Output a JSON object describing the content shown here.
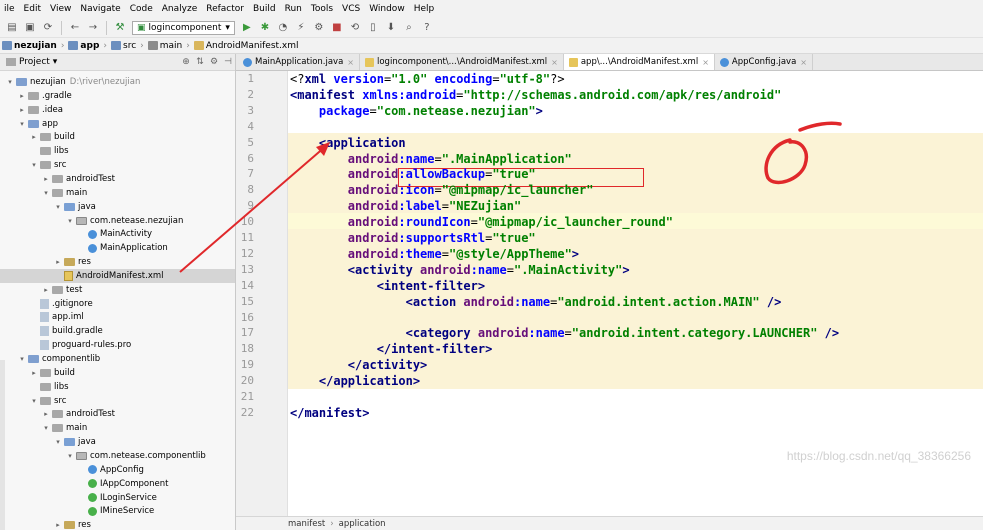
{
  "menu": [
    "ile",
    "Edit",
    "View",
    "Navigate",
    "Code",
    "Analyze",
    "Refactor",
    "Build",
    "Run",
    "Tools",
    "VCS",
    "Window",
    "Help"
  ],
  "toolbar": {
    "run_config": "logincomponent"
  },
  "breadcrumb": [
    "nezujian",
    "app",
    "src",
    "main",
    "AndroidManifest.xml"
  ],
  "project_panel": {
    "title": "Project",
    "tree": [
      {
        "label": "nezujian",
        "extra": "D:\\river\\nezujian",
        "indent": 0,
        "arrow": "▾",
        "icon": "mod"
      },
      {
        "label": ".gradle",
        "indent": 1,
        "arrow": "▸",
        "icon": "folder"
      },
      {
        "label": ".idea",
        "indent": 1,
        "arrow": "▸",
        "icon": "folder"
      },
      {
        "label": "app",
        "indent": 1,
        "arrow": "▾",
        "icon": "mod"
      },
      {
        "label": "build",
        "indent": 2,
        "arrow": "▸",
        "icon": "folder"
      },
      {
        "label": "libs",
        "indent": 2,
        "arrow": "",
        "icon": "folder"
      },
      {
        "label": "src",
        "indent": 2,
        "arrow": "▾",
        "icon": "folder"
      },
      {
        "label": "androidTest",
        "indent": 3,
        "arrow": "▸",
        "icon": "folder"
      },
      {
        "label": "main",
        "indent": 3,
        "arrow": "▾",
        "icon": "folder"
      },
      {
        "label": "java",
        "indent": 4,
        "arrow": "▾",
        "icon": "src"
      },
      {
        "label": "com.netease.nezujian",
        "indent": 5,
        "arrow": "▾",
        "icon": "pkg"
      },
      {
        "label": "MainActivity",
        "indent": 6,
        "arrow": "",
        "icon": "class"
      },
      {
        "label": "MainApplication",
        "indent": 6,
        "arrow": "",
        "icon": "class"
      },
      {
        "label": "res",
        "indent": 4,
        "arrow": "▸",
        "icon": "res"
      },
      {
        "label": "AndroidManifest.xml",
        "indent": 4,
        "arrow": "",
        "icon": "xml",
        "selected": true
      },
      {
        "label": "test",
        "indent": 3,
        "arrow": "▸",
        "icon": "folder"
      },
      {
        "label": ".gitignore",
        "indent": 2,
        "arrow": "",
        "icon": "file"
      },
      {
        "label": "app.iml",
        "indent": 2,
        "arrow": "",
        "icon": "file"
      },
      {
        "label": "build.gradle",
        "indent": 2,
        "arrow": "",
        "icon": "file"
      },
      {
        "label": "proguard-rules.pro",
        "indent": 2,
        "arrow": "",
        "icon": "file"
      },
      {
        "label": "componentlib",
        "indent": 1,
        "arrow": "▾",
        "icon": "mod"
      },
      {
        "label": "build",
        "indent": 2,
        "arrow": "▸",
        "icon": "folder"
      },
      {
        "label": "libs",
        "indent": 2,
        "arrow": "",
        "icon": "folder"
      },
      {
        "label": "src",
        "indent": 2,
        "arrow": "▾",
        "icon": "folder"
      },
      {
        "label": "androidTest",
        "indent": 3,
        "arrow": "▸",
        "icon": "folder"
      },
      {
        "label": "main",
        "indent": 3,
        "arrow": "▾",
        "icon": "folder"
      },
      {
        "label": "java",
        "indent": 4,
        "arrow": "▾",
        "icon": "src"
      },
      {
        "label": "com.netease.componentlib",
        "indent": 5,
        "arrow": "▾",
        "icon": "pkg"
      },
      {
        "label": "AppConfig",
        "indent": 6,
        "arrow": "",
        "icon": "class"
      },
      {
        "label": "IAppComponent",
        "indent": 6,
        "arrow": "",
        "icon": "iface"
      },
      {
        "label": "ILoginService",
        "indent": 6,
        "arrow": "",
        "icon": "iface"
      },
      {
        "label": "IMineService",
        "indent": 6,
        "arrow": "",
        "icon": "iface"
      },
      {
        "label": "res",
        "indent": 4,
        "arrow": "▸",
        "icon": "res"
      }
    ]
  },
  "editor": {
    "tabs": [
      {
        "label": "MainApplication.java",
        "icon": "c",
        "active": false
      },
      {
        "label": "logincomponent\\...\\AndroidManifest.xml",
        "icon": "x",
        "active": false
      },
      {
        "label": "app\\...\\AndroidManifest.xml",
        "icon": "x",
        "active": true
      },
      {
        "label": "AppConfig.java",
        "icon": "c",
        "active": false
      }
    ],
    "lines": [
      [
        [
          "plain",
          "<?"
        ],
        [
          "tag",
          "xml "
        ],
        [
          "attr",
          "version"
        ],
        [
          "plain",
          "="
        ],
        [
          "val",
          "\"1.0\" "
        ],
        [
          "attr",
          "encoding"
        ],
        [
          "plain",
          "="
        ],
        [
          "val",
          "\"utf-8\""
        ],
        [
          "plain",
          "?>"
        ]
      ],
      [
        [
          "tag",
          "<manifest "
        ],
        [
          "attr",
          "xmlns:android"
        ],
        [
          "plain",
          "="
        ],
        [
          "val",
          "\"http://schemas.android.com/apk/res/android\""
        ]
      ],
      [
        [
          "plain",
          "    "
        ],
        [
          "attr",
          "package"
        ],
        [
          "plain",
          "="
        ],
        [
          "val",
          "\"com.netease.nezujian\""
        ],
        [
          "tag",
          ">"
        ]
      ],
      [],
      [
        [
          "plain",
          "    "
        ],
        [
          "tag",
          "<application"
        ]
      ],
      [
        [
          "plain",
          "        "
        ],
        [
          "attrn",
          "android"
        ],
        [
          "attr",
          ":name"
        ],
        [
          "plain",
          "="
        ],
        [
          "val",
          "\".MainApplication\""
        ]
      ],
      [
        [
          "plain",
          "        "
        ],
        [
          "attrn",
          "android"
        ],
        [
          "attr",
          ":allowBackup"
        ],
        [
          "plain",
          "="
        ],
        [
          "val",
          "\"true\""
        ]
      ],
      [
        [
          "plain",
          "        "
        ],
        [
          "attrn",
          "android"
        ],
        [
          "attr",
          ":icon"
        ],
        [
          "plain",
          "="
        ],
        [
          "val",
          "\"@mipmap/ic_launcher\""
        ]
      ],
      [
        [
          "plain",
          "        "
        ],
        [
          "attrn",
          "android"
        ],
        [
          "attr",
          ":label"
        ],
        [
          "plain",
          "="
        ],
        [
          "val",
          "\"NEZujian\""
        ]
      ],
      [
        [
          "plain",
          "        "
        ],
        [
          "attrn",
          "android"
        ],
        [
          "attr",
          ":roundIcon"
        ],
        [
          "plain",
          "="
        ],
        [
          "val",
          "\"@mipmap/ic_launcher_round\""
        ]
      ],
      [
        [
          "plain",
          "        "
        ],
        [
          "attrn",
          "android"
        ],
        [
          "attr",
          ":supportsRtl"
        ],
        [
          "plain",
          "="
        ],
        [
          "val",
          "\"true\""
        ]
      ],
      [
        [
          "plain",
          "        "
        ],
        [
          "attrn",
          "android"
        ],
        [
          "attr",
          ":theme"
        ],
        [
          "plain",
          "="
        ],
        [
          "val",
          "\"@style/AppTheme\""
        ],
        [
          "tag",
          ">"
        ]
      ],
      [
        [
          "plain",
          "        "
        ],
        [
          "tag",
          "<activity "
        ],
        [
          "attrn",
          "android"
        ],
        [
          "attr",
          ":name"
        ],
        [
          "plain",
          "="
        ],
        [
          "val",
          "\".MainActivity\""
        ],
        [
          "tag",
          ">"
        ]
      ],
      [
        [
          "plain",
          "            "
        ],
        [
          "tag",
          "<intent-filter>"
        ]
      ],
      [
        [
          "plain",
          "                "
        ],
        [
          "tag",
          "<action "
        ],
        [
          "attrn",
          "android"
        ],
        [
          "attr",
          ":name"
        ],
        [
          "plain",
          "="
        ],
        [
          "val",
          "\"android.intent.action.MAIN\" "
        ],
        [
          "tag",
          "/>"
        ]
      ],
      [],
      [
        [
          "plain",
          "                "
        ],
        [
          "tag",
          "<category "
        ],
        [
          "attrn",
          "android"
        ],
        [
          "attr",
          ":name"
        ],
        [
          "plain",
          "="
        ],
        [
          "val",
          "\"android.intent.category.LAUNCHER\" "
        ],
        [
          "tag",
          "/>"
        ]
      ],
      [
        [
          "plain",
          "            "
        ],
        [
          "tag",
          "</intent-filter>"
        ]
      ],
      [
        [
          "plain",
          "        "
        ],
        [
          "tag",
          "</activity>"
        ]
      ],
      [
        [
          "plain",
          "    "
        ],
        [
          "tag",
          "</application>"
        ]
      ],
      [],
      [
        [
          "tag",
          "</manifest>"
        ]
      ]
    ]
  },
  "status": [
    "manifest",
    "application"
  ],
  "watermark": "https://blog.csdn.net/qq_38366256",
  "colors": {
    "annotation_red": "#e0282b",
    "highlight_block": "#fbf3d6"
  }
}
